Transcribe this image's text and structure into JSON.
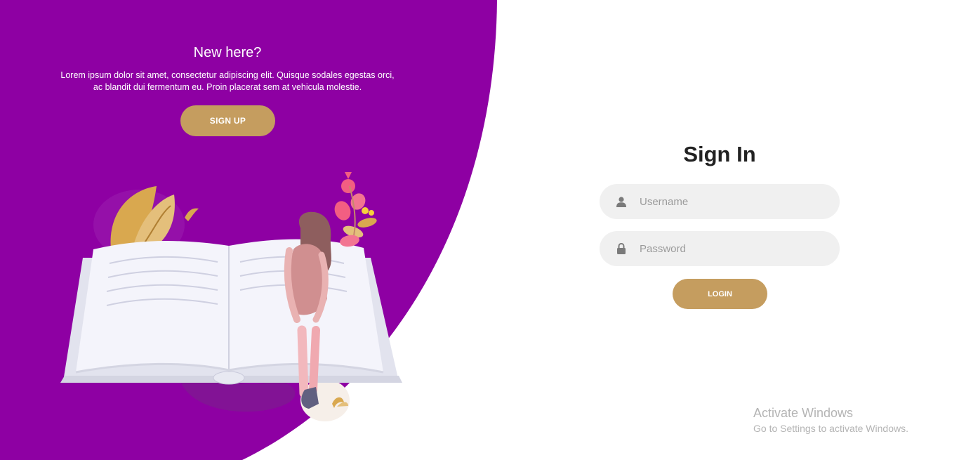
{
  "colors": {
    "panel_purple": "#8e00a3",
    "accent_gold": "#c59d5f",
    "input_bg": "#f0f0f0",
    "title_dark": "#222222"
  },
  "left_panel": {
    "title": "New here?",
    "text": "Lorem ipsum dolor sit amet, consectetur adipiscing elit. Quisque sodales egestas orci, ac blandit dui fermentum eu. Proin placerat sem at vehicula molestie.",
    "signup_label": "SIGN UP",
    "illustration_icon": "reading-woman-book-illustration"
  },
  "signin": {
    "title": "Sign In",
    "username": {
      "placeholder": "Username",
      "value": "",
      "icon": "user-icon"
    },
    "password": {
      "placeholder": "Password",
      "value": "",
      "icon": "lock-icon"
    },
    "login_label": "LOGIN"
  },
  "watermark": {
    "title": "Activate Windows",
    "subtitle": "Go to Settings to activate Windows."
  }
}
